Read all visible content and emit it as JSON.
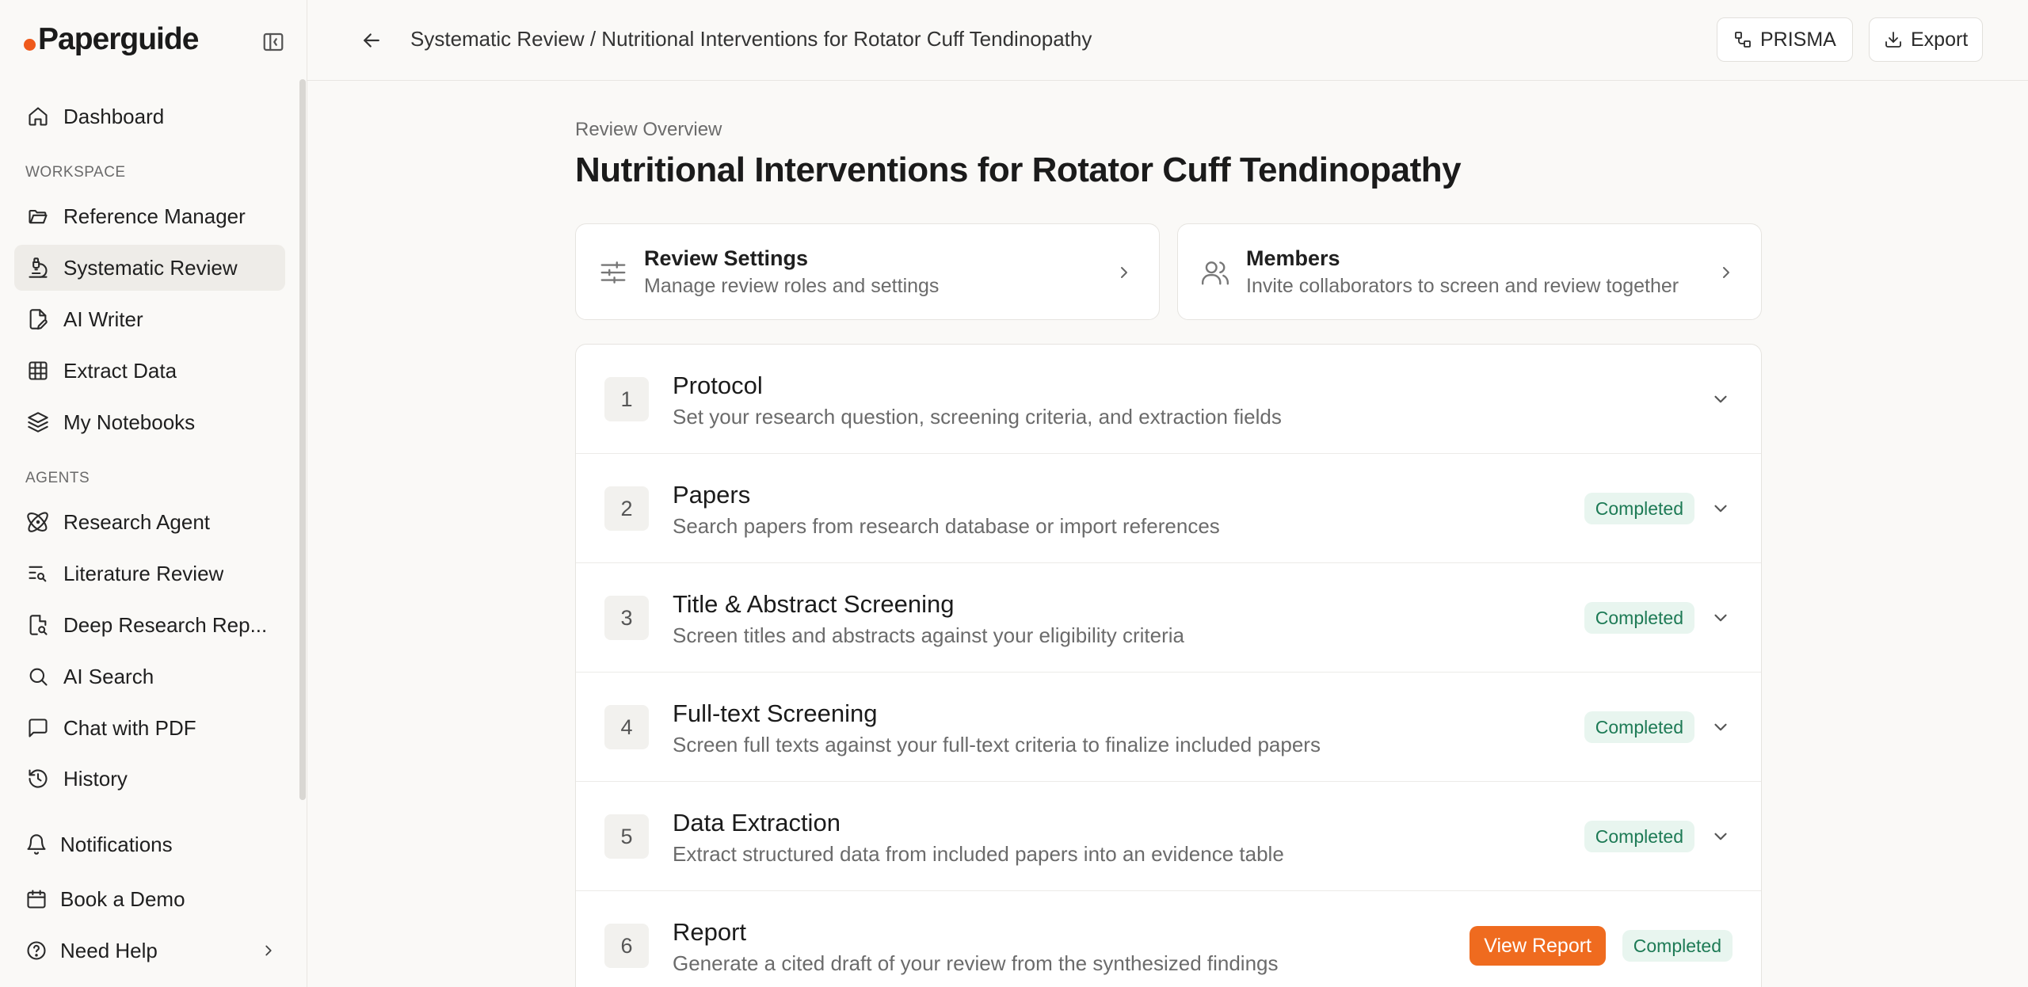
{
  "brand": {
    "name": "Paperguide"
  },
  "sidebar": {
    "items_top": [
      {
        "label": "Dashboard",
        "icon": "home-icon"
      }
    ],
    "workspace_label": "WORKSPACE",
    "workspace": [
      {
        "label": "Reference Manager",
        "icon": "folder-open-icon"
      },
      {
        "label": "Systematic Review",
        "icon": "microscope-icon",
        "active": true
      },
      {
        "label": "AI Writer",
        "icon": "file-pen-icon"
      },
      {
        "label": "Extract Data",
        "icon": "table-icon"
      },
      {
        "label": "My Notebooks",
        "icon": "layers-icon"
      }
    ],
    "agents_label": "AGENTS",
    "agents": [
      {
        "label": "Research Agent",
        "icon": "atom-icon"
      },
      {
        "label": "Literature Review",
        "icon": "list-search-icon"
      },
      {
        "label": "Deep Research Rep...",
        "icon": "file-search-icon"
      },
      {
        "label": "AI Search",
        "icon": "search-icon"
      },
      {
        "label": "Chat with PDF",
        "icon": "message-square-icon"
      },
      {
        "label": "History",
        "icon": "history-icon"
      }
    ],
    "bottom": [
      {
        "label": "Notifications",
        "icon": "bell-icon"
      },
      {
        "label": "Book a Demo",
        "icon": "calendar-icon"
      },
      {
        "label": "Need Help",
        "icon": "help-circle-icon"
      }
    ]
  },
  "header": {
    "breadcrumb": "Systematic Review / Nutritional Interventions for Rotator Cuff Tendinopathy",
    "prisma_label": "PRISMA",
    "export_label": "Export"
  },
  "main": {
    "eyebrow": "Review Overview",
    "title": "Nutritional Interventions for Rotator Cuff Tendinopathy",
    "cards": [
      {
        "title": "Review Settings",
        "subtitle": "Manage review roles and settings",
        "icon": "sliders-icon"
      },
      {
        "title": "Members",
        "subtitle": "Invite collaborators to screen and review together",
        "icon": "users-icon"
      }
    ],
    "steps": [
      {
        "num": "1",
        "title": "Protocol",
        "subtitle": "Set your research question, screening criteria, and extraction fields",
        "status": ""
      },
      {
        "num": "2",
        "title": "Papers",
        "subtitle": "Search papers from research database or import references",
        "status": "Completed"
      },
      {
        "num": "3",
        "title": "Title & Abstract Screening",
        "subtitle": "Screen titles and abstracts against your eligibility criteria",
        "status": "Completed"
      },
      {
        "num": "4",
        "title": "Full-text Screening",
        "subtitle": "Screen full texts against your full-text criteria to finalize included papers",
        "status": "Completed"
      },
      {
        "num": "5",
        "title": "Data Extraction",
        "subtitle": "Extract structured data from included papers into an evidence table",
        "status": "Completed"
      },
      {
        "num": "6",
        "title": "Report",
        "subtitle": "Generate a cited draft of your review from the synthesized findings",
        "status": "Completed",
        "action": "View Report"
      }
    ]
  },
  "colors": {
    "accent": "#ef6b1f",
    "brand_dot": "#ef5a1c",
    "completed_bg": "#e8f5ef",
    "completed_text": "#1d7a55"
  }
}
